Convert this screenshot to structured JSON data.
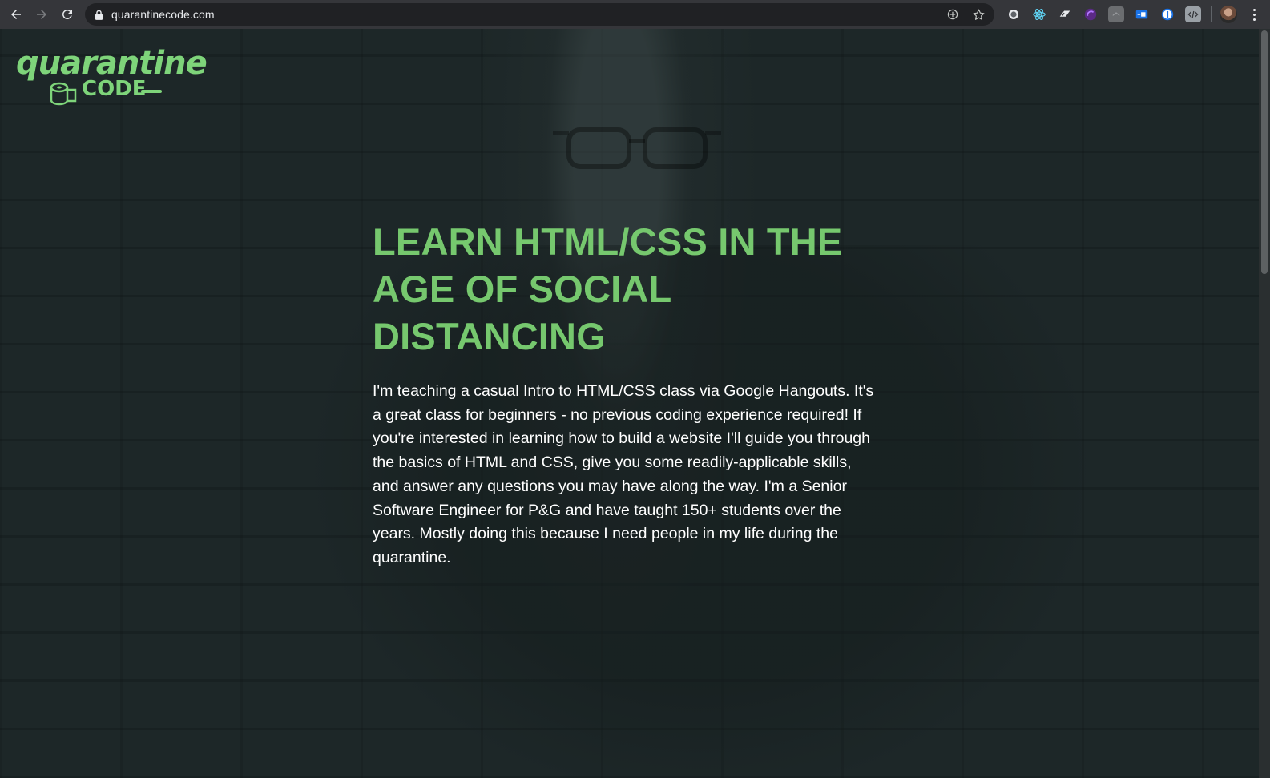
{
  "browser": {
    "url": "quarantinecode.com",
    "extensions": [
      "record-icon",
      "react-devtools-icon",
      "extension-icon",
      "purple-extension-icon",
      "grey-extension-icon",
      "blue-extension-icon",
      "1password-icon",
      "devtools-icon"
    ]
  },
  "site": {
    "logo_line1": "quarantine",
    "logo_line2": "CODE",
    "hero_title": "LEARN HTML/CSS IN THE AGE OF SOCIAL DISTANCING",
    "hero_body": "I'm teaching a casual Intro to HTML/CSS class via Google Hangouts. It's a great class for beginners - no previous coding experience required! If you're interested in learning how to build a website I'll guide you through the basics of HTML and CSS, give you some readily-applicable skills, and answer any questions you may have along the way. I'm a Senior Software Engineer for P&G and have taught 150+ students over the years. Mostly doing this because I need people in my life during the quarantine."
  },
  "colors": {
    "accent_green": "#76c86e",
    "background": "#1d2728"
  }
}
